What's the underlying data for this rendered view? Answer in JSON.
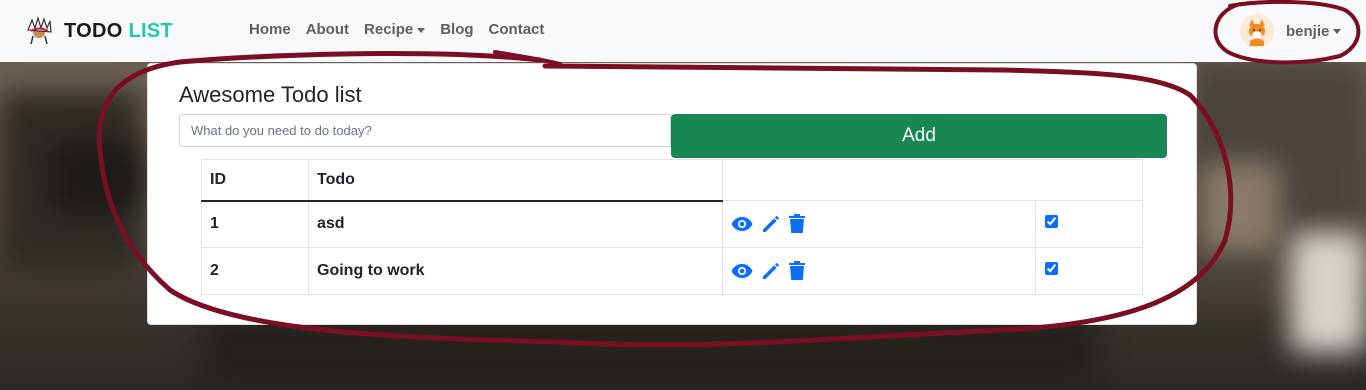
{
  "brand": {
    "name_main": "TODO",
    "name_accent": "LIST",
    "logo_icon": "chief-headdress-logo-icon"
  },
  "nav": [
    {
      "label": "Home"
    },
    {
      "label": "About"
    },
    {
      "label": "Recipe",
      "dropdown": true
    },
    {
      "label": "Blog"
    },
    {
      "label": "Contact"
    }
  ],
  "user": {
    "name": "benjie",
    "avatar_icon": "fox-avatar-icon"
  },
  "card": {
    "title": "Awesome Todo list",
    "input_placeholder": "What do you need to do today?",
    "add_label": "Add"
  },
  "table": {
    "headers": {
      "id": "ID",
      "todo": "Todo"
    },
    "rows": [
      {
        "id": "1",
        "todo": "asd",
        "checked": true
      },
      {
        "id": "2",
        "todo": "Going to work",
        "checked": true
      }
    ]
  },
  "colors": {
    "accent": "#20c9b5",
    "add_button": "#198754",
    "icon_blue": "#0d6efd",
    "annotation": "#7a0f23"
  }
}
